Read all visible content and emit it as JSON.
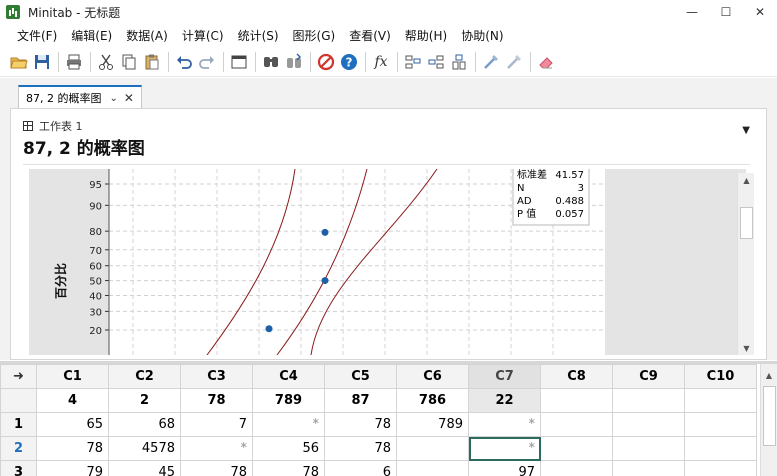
{
  "window": {
    "title": "Minitab - 无标题",
    "minimize": "—",
    "maximize": "☐",
    "close": "✕"
  },
  "menu": [
    "文件(F)",
    "编辑(E)",
    "数据(A)",
    "计算(C)",
    "统计(S)",
    "图形(G)",
    "查看(V)",
    "帮助(H)",
    "协助(N)"
  ],
  "toolbar": {
    "icons": [
      "open-folder-icon",
      "save-icon",
      "print-icon",
      "cut-icon",
      "copy-icon",
      "paste-icon",
      "undo-icon",
      "redo-icon",
      "window-icon",
      "find-icon",
      "replace-icon",
      "cancel-icon",
      "help-icon",
      "function-icon",
      "insert-row-icon",
      "insert-column-icon",
      "insert-cell-icon",
      "brush-icon",
      "brush-alt-icon",
      "eraser-icon"
    ],
    "fx": "fx"
  },
  "tab": {
    "label": "87, 2 的概率图",
    "chevron": "⌄",
    "close": "✕"
  },
  "output": {
    "breadcrumb": "工作表 1",
    "title": "87, 2 的概率图",
    "menu_caret": "▼"
  },
  "chart_data": {
    "type": "scatter",
    "ylabel": "百分比",
    "y_ticks": [
      95,
      90,
      80,
      70,
      60,
      50,
      40,
      30,
      20
    ],
    "points": [
      {
        "percent": 79.4
      },
      {
        "percent": 50.0
      },
      {
        "percent": 20.6
      }
    ],
    "stats": [
      {
        "label": "标准差",
        "value": "41.57"
      },
      {
        "label": "N",
        "value": "3"
      },
      {
        "label": "AD",
        "value": "0.488"
      },
      {
        "label": "P 值",
        "value": "0.057"
      }
    ],
    "colors": {
      "points": "#1f5fa8",
      "fit_lines": "#8b1a1a"
    },
    "grid": true
  },
  "sheet": {
    "corner": "➜",
    "columns": [
      "C1",
      "C2",
      "C3",
      "C4",
      "C5",
      "C6",
      "C7",
      "C8",
      "C9",
      "C10"
    ],
    "names": [
      "4",
      "2",
      "78",
      "789",
      "87",
      "786",
      "22",
      "",
      "",
      ""
    ],
    "active_column": "C7",
    "rows": [
      {
        "id": "1",
        "cells": [
          "65",
          "68",
          "7",
          "*",
          "78",
          "789",
          "*",
          "",
          "",
          ""
        ]
      },
      {
        "id": "2",
        "cells": [
          "78",
          "4578",
          "*",
          "56",
          "78",
          "",
          "*",
          "",
          "",
          ""
        ]
      },
      {
        "id": "3",
        "cells": [
          "79",
          "45",
          "78",
          "78",
          "6",
          "",
          "97",
          "",
          "",
          ""
        ]
      }
    ]
  }
}
